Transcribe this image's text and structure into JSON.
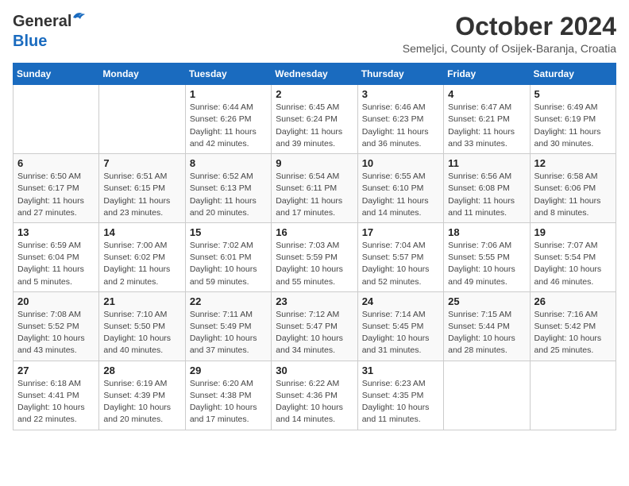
{
  "header": {
    "logo_general": "General",
    "logo_blue": "Blue",
    "month_title": "October 2024",
    "location": "Semeljci, County of Osijek-Baranja, Croatia"
  },
  "weekdays": [
    "Sunday",
    "Monday",
    "Tuesday",
    "Wednesday",
    "Thursday",
    "Friday",
    "Saturday"
  ],
  "weeks": [
    [
      {
        "day": "",
        "sunrise": "",
        "sunset": "",
        "daylight": ""
      },
      {
        "day": "",
        "sunrise": "",
        "sunset": "",
        "daylight": ""
      },
      {
        "day": "1",
        "sunrise": "Sunrise: 6:44 AM",
        "sunset": "Sunset: 6:26 PM",
        "daylight": "Daylight: 11 hours and 42 minutes."
      },
      {
        "day": "2",
        "sunrise": "Sunrise: 6:45 AM",
        "sunset": "Sunset: 6:24 PM",
        "daylight": "Daylight: 11 hours and 39 minutes."
      },
      {
        "day": "3",
        "sunrise": "Sunrise: 6:46 AM",
        "sunset": "Sunset: 6:23 PM",
        "daylight": "Daylight: 11 hours and 36 minutes."
      },
      {
        "day": "4",
        "sunrise": "Sunrise: 6:47 AM",
        "sunset": "Sunset: 6:21 PM",
        "daylight": "Daylight: 11 hours and 33 minutes."
      },
      {
        "day": "5",
        "sunrise": "Sunrise: 6:49 AM",
        "sunset": "Sunset: 6:19 PM",
        "daylight": "Daylight: 11 hours and 30 minutes."
      }
    ],
    [
      {
        "day": "6",
        "sunrise": "Sunrise: 6:50 AM",
        "sunset": "Sunset: 6:17 PM",
        "daylight": "Daylight: 11 hours and 27 minutes."
      },
      {
        "day": "7",
        "sunrise": "Sunrise: 6:51 AM",
        "sunset": "Sunset: 6:15 PM",
        "daylight": "Daylight: 11 hours and 23 minutes."
      },
      {
        "day": "8",
        "sunrise": "Sunrise: 6:52 AM",
        "sunset": "Sunset: 6:13 PM",
        "daylight": "Daylight: 11 hours and 20 minutes."
      },
      {
        "day": "9",
        "sunrise": "Sunrise: 6:54 AM",
        "sunset": "Sunset: 6:11 PM",
        "daylight": "Daylight: 11 hours and 17 minutes."
      },
      {
        "day": "10",
        "sunrise": "Sunrise: 6:55 AM",
        "sunset": "Sunset: 6:10 PM",
        "daylight": "Daylight: 11 hours and 14 minutes."
      },
      {
        "day": "11",
        "sunrise": "Sunrise: 6:56 AM",
        "sunset": "Sunset: 6:08 PM",
        "daylight": "Daylight: 11 hours and 11 minutes."
      },
      {
        "day": "12",
        "sunrise": "Sunrise: 6:58 AM",
        "sunset": "Sunset: 6:06 PM",
        "daylight": "Daylight: 11 hours and 8 minutes."
      }
    ],
    [
      {
        "day": "13",
        "sunrise": "Sunrise: 6:59 AM",
        "sunset": "Sunset: 6:04 PM",
        "daylight": "Daylight: 11 hours and 5 minutes."
      },
      {
        "day": "14",
        "sunrise": "Sunrise: 7:00 AM",
        "sunset": "Sunset: 6:02 PM",
        "daylight": "Daylight: 11 hours and 2 minutes."
      },
      {
        "day": "15",
        "sunrise": "Sunrise: 7:02 AM",
        "sunset": "Sunset: 6:01 PM",
        "daylight": "Daylight: 10 hours and 59 minutes."
      },
      {
        "day": "16",
        "sunrise": "Sunrise: 7:03 AM",
        "sunset": "Sunset: 5:59 PM",
        "daylight": "Daylight: 10 hours and 55 minutes."
      },
      {
        "day": "17",
        "sunrise": "Sunrise: 7:04 AM",
        "sunset": "Sunset: 5:57 PM",
        "daylight": "Daylight: 10 hours and 52 minutes."
      },
      {
        "day": "18",
        "sunrise": "Sunrise: 7:06 AM",
        "sunset": "Sunset: 5:55 PM",
        "daylight": "Daylight: 10 hours and 49 minutes."
      },
      {
        "day": "19",
        "sunrise": "Sunrise: 7:07 AM",
        "sunset": "Sunset: 5:54 PM",
        "daylight": "Daylight: 10 hours and 46 minutes."
      }
    ],
    [
      {
        "day": "20",
        "sunrise": "Sunrise: 7:08 AM",
        "sunset": "Sunset: 5:52 PM",
        "daylight": "Daylight: 10 hours and 43 minutes."
      },
      {
        "day": "21",
        "sunrise": "Sunrise: 7:10 AM",
        "sunset": "Sunset: 5:50 PM",
        "daylight": "Daylight: 10 hours and 40 minutes."
      },
      {
        "day": "22",
        "sunrise": "Sunrise: 7:11 AM",
        "sunset": "Sunset: 5:49 PM",
        "daylight": "Daylight: 10 hours and 37 minutes."
      },
      {
        "day": "23",
        "sunrise": "Sunrise: 7:12 AM",
        "sunset": "Sunset: 5:47 PM",
        "daylight": "Daylight: 10 hours and 34 minutes."
      },
      {
        "day": "24",
        "sunrise": "Sunrise: 7:14 AM",
        "sunset": "Sunset: 5:45 PM",
        "daylight": "Daylight: 10 hours and 31 minutes."
      },
      {
        "day": "25",
        "sunrise": "Sunrise: 7:15 AM",
        "sunset": "Sunset: 5:44 PM",
        "daylight": "Daylight: 10 hours and 28 minutes."
      },
      {
        "day": "26",
        "sunrise": "Sunrise: 7:16 AM",
        "sunset": "Sunset: 5:42 PM",
        "daylight": "Daylight: 10 hours and 25 minutes."
      }
    ],
    [
      {
        "day": "27",
        "sunrise": "Sunrise: 6:18 AM",
        "sunset": "Sunset: 4:41 PM",
        "daylight": "Daylight: 10 hours and 22 minutes."
      },
      {
        "day": "28",
        "sunrise": "Sunrise: 6:19 AM",
        "sunset": "Sunset: 4:39 PM",
        "daylight": "Daylight: 10 hours and 20 minutes."
      },
      {
        "day": "29",
        "sunrise": "Sunrise: 6:20 AM",
        "sunset": "Sunset: 4:38 PM",
        "daylight": "Daylight: 10 hours and 17 minutes."
      },
      {
        "day": "30",
        "sunrise": "Sunrise: 6:22 AM",
        "sunset": "Sunset: 4:36 PM",
        "daylight": "Daylight: 10 hours and 14 minutes."
      },
      {
        "day": "31",
        "sunrise": "Sunrise: 6:23 AM",
        "sunset": "Sunset: 4:35 PM",
        "daylight": "Daylight: 10 hours and 11 minutes."
      },
      {
        "day": "",
        "sunrise": "",
        "sunset": "",
        "daylight": ""
      },
      {
        "day": "",
        "sunrise": "",
        "sunset": "",
        "daylight": ""
      }
    ]
  ]
}
